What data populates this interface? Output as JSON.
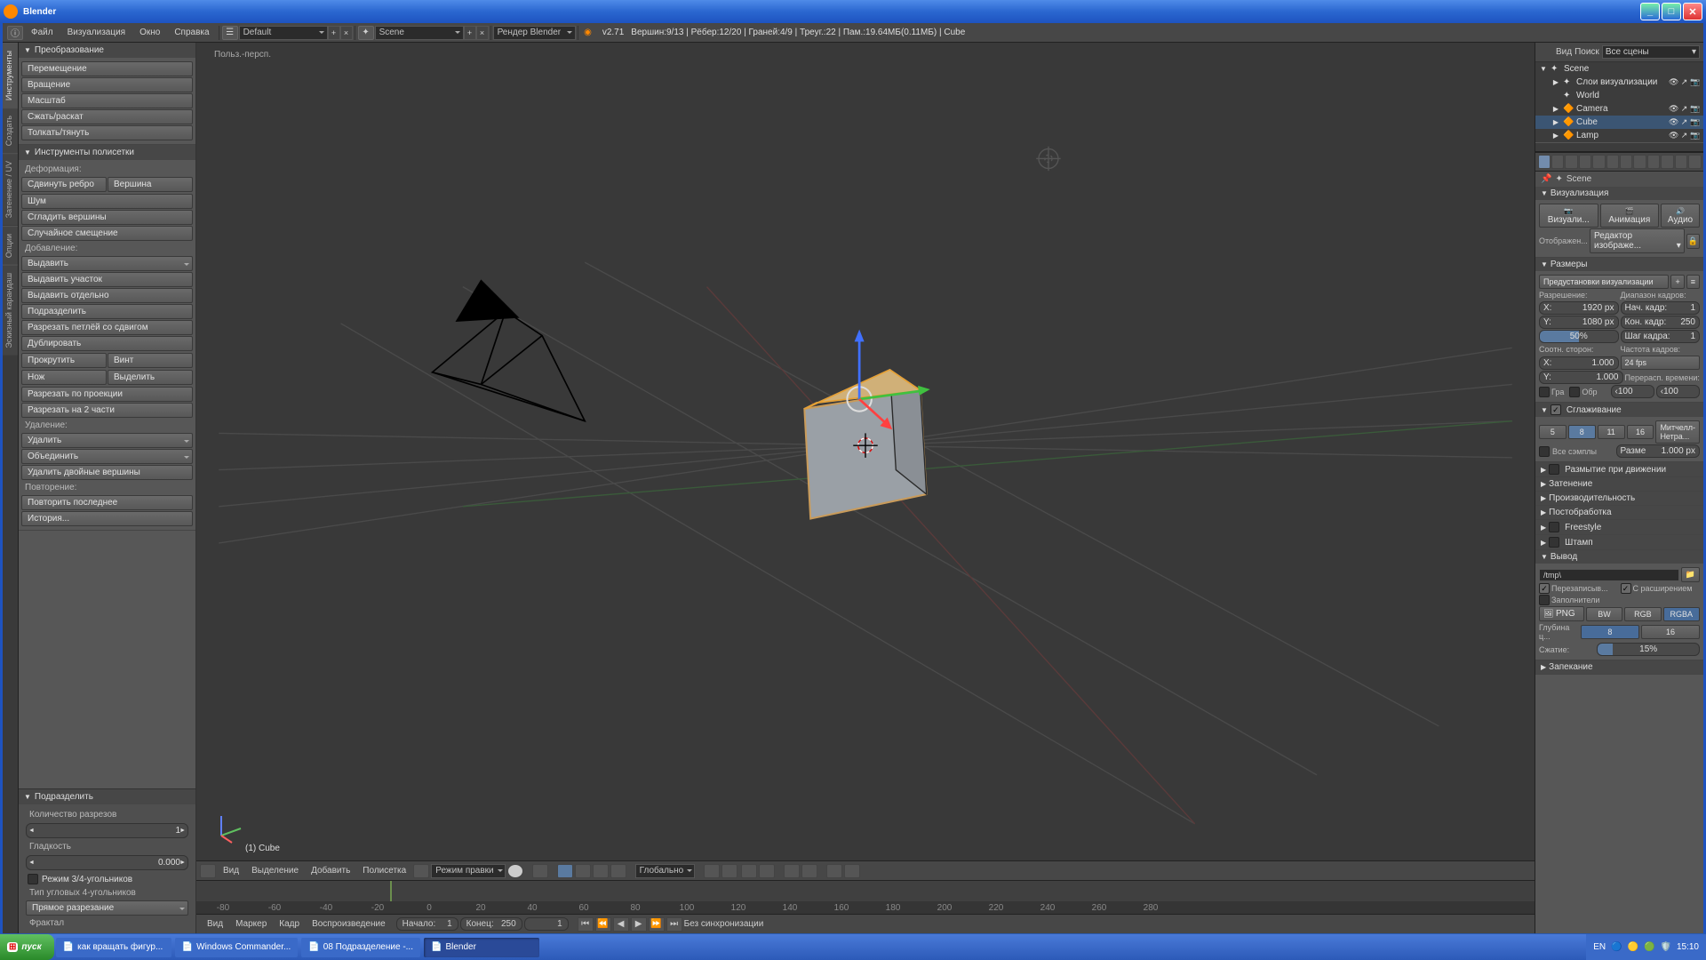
{
  "window": {
    "title": "Blender"
  },
  "menubar": {
    "items": [
      "Файл",
      "Визуализация",
      "Окно",
      "Справка"
    ],
    "layout_dd": "Default",
    "scene_dd": "Scene",
    "renderer_dd": "Рендер Blender",
    "version": "v2.71",
    "status": "Вершин:9/13 | Рёбер:12/20 | Граней:4/9 | Треуг.:22 | Пам.:19.64МБ(0.11МБ) | Cube"
  },
  "sidetabs": [
    "Инструменты",
    "Создать",
    "Затенение / UV",
    "Опции",
    "Эскизный карандаш"
  ],
  "tools": {
    "transform_title": "Преобразование",
    "translate": "Перемещение",
    "rotate": "Вращение",
    "scale": "Масштаб",
    "shrink": "Сжать/раскат",
    "push": "Толкать/тянуть",
    "mesh_title": "Инструменты полисетки",
    "deform_label": "Деформация:",
    "edge_slide": "Сдвинуть ребро",
    "vertex": "Вершина",
    "noise": "Шум",
    "smooth_v": "Сгладить вершины",
    "random": "Случайное смещение",
    "add_label": "Добавление:",
    "extrude": "Выдавить",
    "extrude_region": "Выдавить участок",
    "extrude_ind": "Выдавить отдельно",
    "subdivide": "Подразделить",
    "loopcut": "Разрезать петлёй со сдвигом",
    "duplicate": "Дублировать",
    "scroll": "Прокрутить",
    "screw": "Винт",
    "knife": "Нож",
    "select": "Выделить",
    "project": "Разрезать по проекции",
    "bisect": "Разрезать на 2 части",
    "remove_label": "Удаление:",
    "delete": "Удалить",
    "merge": "Объединить",
    "rem_double": "Удалить двойные вершины",
    "repeat_label": "Повторение:",
    "repeat_last": "Повторить последнее",
    "history": "История...",
    "op_title": "Подразделить",
    "cuts_label": "Количество разрезов",
    "cuts_val": "1",
    "smooth_label": "Гладкость",
    "smooth_val": "0.000",
    "quad_tri": "Режим 3/4-угольников",
    "corner_label": "Тип угловых 4-угольников",
    "corner_val": "Прямое разрезание",
    "fractal": "Фрактал"
  },
  "viewport": {
    "label": "Польз.-персп.",
    "object": "(1) Cube",
    "hdr_menus": [
      "Вид",
      "Выделение",
      "Добавить",
      "Полисетка"
    ],
    "mode": "Режим правки",
    "orientation": "Глобально"
  },
  "timeline": {
    "ticks": [
      "-80",
      "-60",
      "-40",
      "-20",
      "0",
      "20",
      "40",
      "60",
      "80",
      "100",
      "120",
      "140",
      "160",
      "180",
      "200",
      "220",
      "240",
      "260",
      "280"
    ],
    "hdr_menus": [
      "Вид",
      "Маркер",
      "Кадр",
      "Воспроизведение"
    ],
    "start_label": "Начало:",
    "start": "1",
    "end_label": "Конец:",
    "end": "250",
    "current": "1",
    "sync": "Без синхронизации"
  },
  "outliner": {
    "hdr_menus": [
      "Вид",
      "Поиск"
    ],
    "filter": "Все сцены",
    "items": [
      {
        "name": "Scene",
        "ind": 0,
        "exp": "▼",
        "sel": false
      },
      {
        "name": "Слои визуализации",
        "ind": 1,
        "exp": "▶",
        "sel": false,
        "trail": true
      },
      {
        "name": "World",
        "ind": 1,
        "exp": "",
        "sel": false
      },
      {
        "name": "Camera",
        "ind": 1,
        "exp": "▶",
        "sel": false,
        "trail": true,
        "obj": true
      },
      {
        "name": "Cube",
        "ind": 1,
        "exp": "▶",
        "sel": true,
        "trail": true,
        "obj": true
      },
      {
        "name": "Lamp",
        "ind": 1,
        "exp": "▶",
        "sel": false,
        "trail": true,
        "obj": true
      }
    ]
  },
  "props": {
    "crumb": "Scene",
    "render_title": "Визуализация",
    "btn_render": "Визуали...",
    "btn_anim": "Анимация",
    "btn_audio": "Аудио",
    "display_label": "Отображен...",
    "display_val": "Редактор изображе...",
    "dim_title": "Размеры",
    "preset": "Предустановки визуализации",
    "res_label": "Разрешение:",
    "frame_label": "Диапазон кадров:",
    "x_label": "X:",
    "x_val": "1920 px",
    "start_l": "Нач. кадр:",
    "start_v": "1",
    "y_label": "Y:",
    "y_val": "1080 px",
    "end_l": "Кон. кадр:",
    "end_v": "250",
    "pct": "50%",
    "step_l": "Шаг кадра:",
    "step_v": "1",
    "aspect_l": "Соотн. сторон:",
    "rate_l": "Частота кадров:",
    "ax": "1.000",
    "fps": "24 fps",
    "ay": "1.000",
    "remap_l": "Перерасп. времени:",
    "border": "Гра",
    "crop": "Обр",
    "r1": "‹100",
    "r2": "‹100",
    "aa_title": "Сглаживание",
    "aa5": "5",
    "aa8": "8",
    "aa11": "11",
    "aa16": "16",
    "aa_filter": "Митчелл-Нетра...",
    "full": "Все сэмплы",
    "size_l": "Разме",
    "size_v": "1.000 px",
    "mblur": "Размытие при движении",
    "shading": "Затенение",
    "perf": "Производительность",
    "post": "Постобработка",
    "freestyle": "Freestyle",
    "stamp": "Штамп",
    "out_title": "Вывод",
    "out_path": "/tmp\\",
    "overwrite": "Перезаписыв...",
    "ext": "С расширением",
    "placeholder": "Заполнители",
    "fmt": "PNG",
    "bw": "BW",
    "rgb": "RGB",
    "rgba": "RGBA",
    "depth_l": "Глубина ц...",
    "d8": "8",
    "d16": "16",
    "comp_l": "Сжатие:",
    "comp_v": "15%",
    "bake": "Запекание"
  },
  "taskbar": {
    "start": "пуск",
    "items": [
      "как вращать фигур...",
      "Windows Commander...",
      "08 Подразделение -...",
      "Blender"
    ],
    "active": 3,
    "lang": "EN",
    "time": "15:10"
  }
}
